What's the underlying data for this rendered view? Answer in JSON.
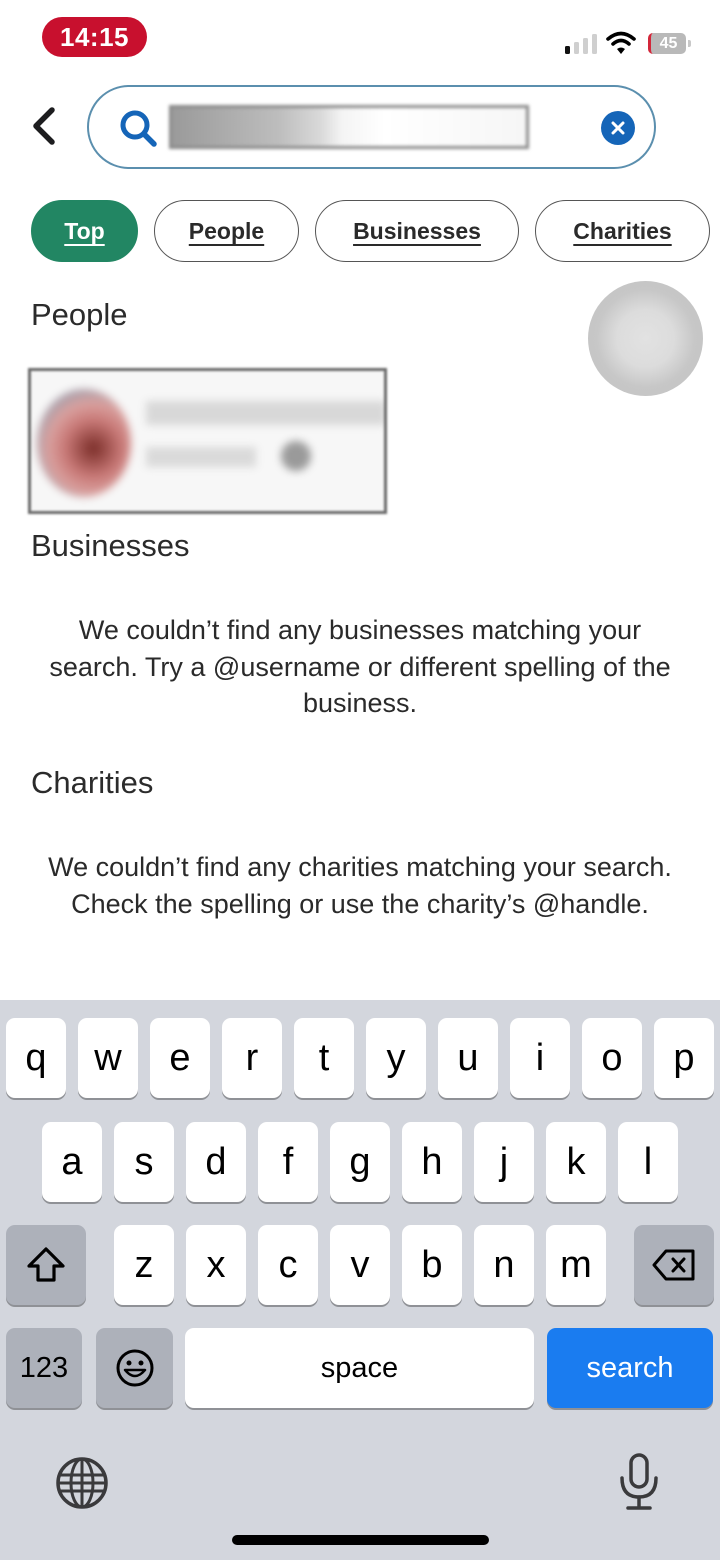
{
  "status_bar": {
    "time": "14:15",
    "battery_level": "45",
    "battery_charging": true,
    "signal_bars_active": 1,
    "signal_bars_total": 4,
    "icons": [
      "cellular-signal-icon",
      "wifi-icon",
      "battery-charging-icon"
    ],
    "time_pill_color": "#c8102e"
  },
  "header": {
    "back_icon": "chevron-left-icon",
    "search": {
      "icon": "search-icon",
      "value": "[redacted]",
      "clear_icon": "clear-circle-x-icon"
    }
  },
  "filters": {
    "accent_color": "#228663",
    "items": [
      {
        "label": "Top",
        "active": true
      },
      {
        "label": "People",
        "active": false
      },
      {
        "label": "Businesses",
        "active": false
      },
      {
        "label": "Charities",
        "active": false
      }
    ]
  },
  "sections": {
    "people": {
      "title": "People",
      "results": [
        {
          "name": "[redacted]",
          "handle": "[redacted]"
        }
      ]
    },
    "businesses": {
      "title": "Businesses",
      "empty_message": "We couldn’t find any businesses matching your search. Try a @username or different spelling of the business."
    },
    "charities": {
      "title": "Charities",
      "empty_message": "We couldn’t find any charities matching your search. Check the spelling or use the charity’s @handle."
    }
  },
  "keyboard": {
    "row1": [
      "q",
      "w",
      "e",
      "r",
      "t",
      "y",
      "u",
      "i",
      "o",
      "p"
    ],
    "row2": [
      "a",
      "s",
      "d",
      "f",
      "g",
      "h",
      "j",
      "k",
      "l"
    ],
    "row3": [
      "z",
      "x",
      "c",
      "v",
      "b",
      "n",
      "m"
    ],
    "shift_icon": "shift-arrow-icon",
    "delete_icon": "backspace-icon",
    "numbers_label": "123",
    "emoji_icon": "emoji-smile-icon",
    "space_label": "space",
    "action_label": "search",
    "action_color": "#1a7cf0",
    "globe_icon": "globe-icon",
    "mic_icon": "microphone-icon"
  }
}
